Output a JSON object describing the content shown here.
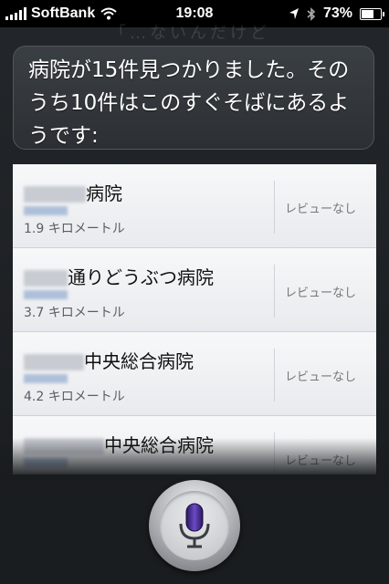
{
  "status_bar": {
    "carrier": "SoftBank",
    "time": "19:08",
    "battery": "73%",
    "battery_level": 0.73
  },
  "background_ghost_text": "「…ないんだけど",
  "siri": {
    "response": "病院が15件見つかりました。そのうち10件はこのすぐそばにあるようです:"
  },
  "results": [
    {
      "name_suffix": "病院",
      "distance": "1.9 キロメートル",
      "review": "レビューなし"
    },
    {
      "name_suffix": "通りどうぶつ病院",
      "distance": "3.7 キロメートル",
      "review": "レビューなし"
    },
    {
      "name_suffix": "中央総合病院",
      "distance": "4.2 キロメートル",
      "review": "レビューなし"
    },
    {
      "name_suffix": "中央総合病院",
      "distance": "",
      "review": "レビューなし"
    }
  ],
  "colors": {
    "siri_purple": "#4b2a8c",
    "background": "#1e2124"
  },
  "icons": {
    "mic": "microphone-icon",
    "wifi": "wifi-icon",
    "location": "location-arrow-icon",
    "bluetooth": "bluetooth-icon"
  }
}
